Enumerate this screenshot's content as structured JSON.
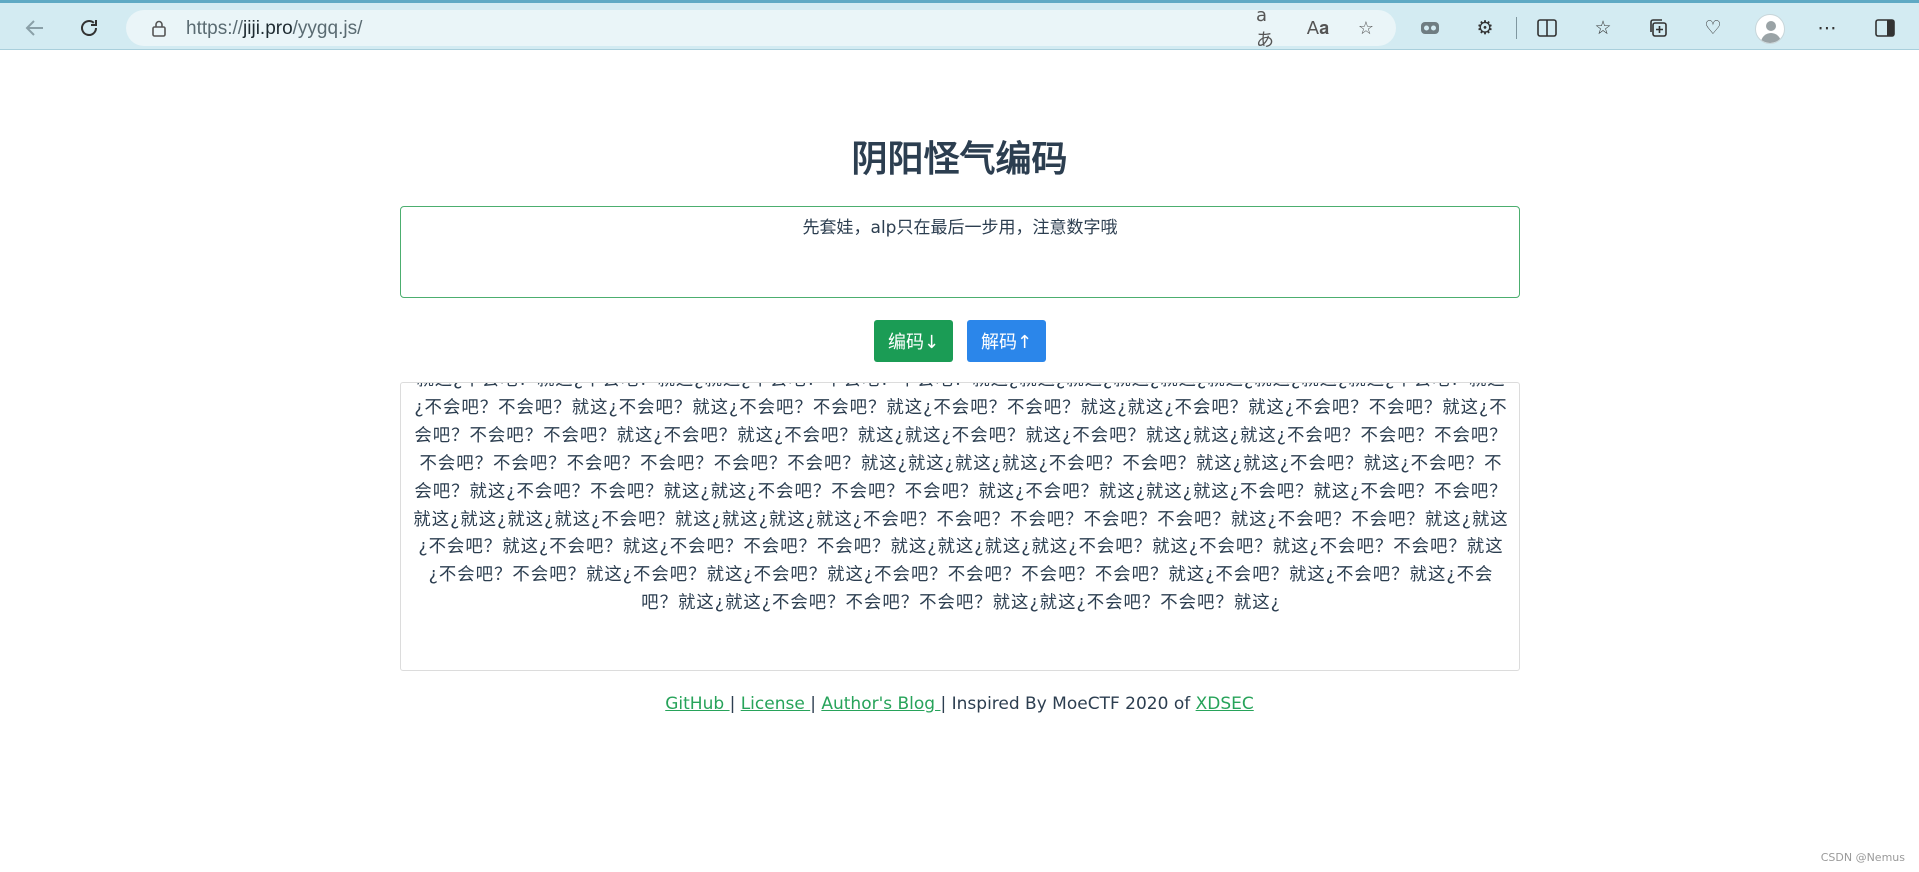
{
  "browser": {
    "url_prefix": "https://",
    "url_host": "jiji.pro",
    "url_path": "/yygq.js/"
  },
  "icons": {
    "back": "arrow-left-icon",
    "reload": "reload-icon",
    "lock": "lock-icon",
    "translate": "translate-icon",
    "read_aloud": "read-aloud-icon",
    "favorite": "star-icon",
    "extensions": "extensions-icon",
    "split": "split-screen-icon",
    "favorites": "favorites-icon",
    "collections": "collections-icon",
    "health": "browser-essentials-icon",
    "profile": "profile-icon",
    "menu": "more-icon",
    "sidebar": "sidebar-icon"
  },
  "page": {
    "title": "阴阳怪气编码",
    "input_text": "先套娃，alp只在最后一步用，注意数字哦",
    "encode_label": "编码↓",
    "decode_label": "解码↑",
    "output_text": "就这¿不会吧？就这¿不会吧？就这¿就这¿不会吧？不会吧？不会吧？就这¿就这¿就这¿就这¿就这¿就这¿就这¿就这¿就这¿不会吧？就这¿不会吧？不会吧？就这¿不会吧？就这¿不会吧？不会吧？就这¿不会吧？不会吧？就这¿就这¿不会吧？就这¿不会吧？不会吧？就这¿不会吧？不会吧？不会吧？就这¿不会吧？就这¿不会吧？就这¿就这¿不会吧？就这¿不会吧？就这¿就这¿就这¿不会吧？不会吧？不会吧？不会吧？不会吧？不会吧？不会吧？不会吧？不会吧？就这¿就这¿就这¿就这¿不会吧？不会吧？就这¿就这¿不会吧？就这¿不会吧？不会吧？就这¿不会吧？不会吧？就这¿就这¿不会吧？不会吧？不会吧？就这¿不会吧？就这¿就这¿就这¿不会吧？就这¿不会吧？不会吧？就这¿就这¿就这¿就这¿不会吧？就这¿就这¿就这¿就这¿不会吧？不会吧？不会吧？不会吧？不会吧？就这¿不会吧？不会吧？就这¿就这¿不会吧？就这¿不会吧？就这¿不会吧？不会吧？不会吧？就这¿就这¿就这¿就这¿不会吧？就这¿不会吧？就这¿不会吧？不会吧？就这¿不会吧？不会吧？就这¿不会吧？就这¿不会吧？就这¿不会吧？不会吧？不会吧？不会吧？就这¿不会吧？就这¿不会吧？就这¿不会吧？就这¿就这¿不会吧？不会吧？不会吧？就这¿就这¿不会吧？不会吧？就这¿"
  },
  "footer": {
    "github": "GitHub ",
    "sep1": "| ",
    "license": "License ",
    "sep2": "| ",
    "blog": "Author's Blog ",
    "inspired": "| Inspired By MoeCTF 2020 of ",
    "xdsec": "XDSEC"
  },
  "watermark": "CSDN @Nemus"
}
